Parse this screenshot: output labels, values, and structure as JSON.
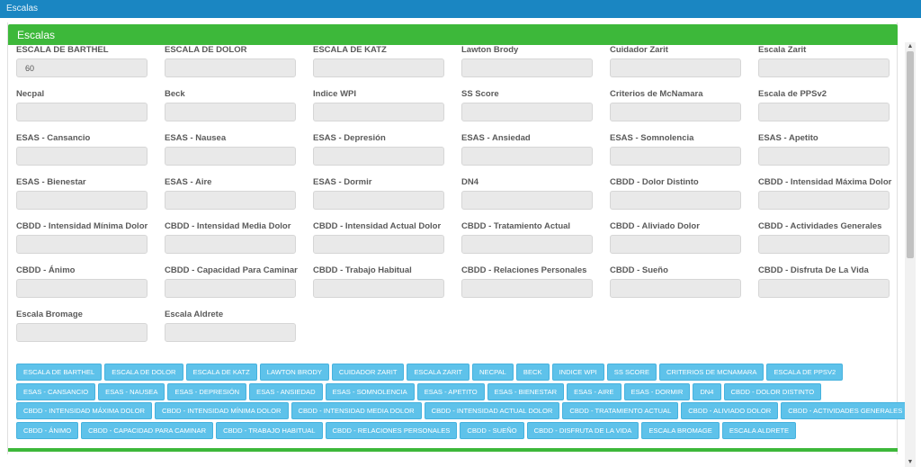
{
  "window": {
    "title": "Escalas"
  },
  "panel": {
    "title": "Escalas"
  },
  "fields": [
    {
      "label": "ESCALA DE BARTHEL",
      "value": "60"
    },
    {
      "label": "ESCALA DE DOLOR",
      "value": ""
    },
    {
      "label": "ESCALA DE KATZ",
      "value": ""
    },
    {
      "label": "Lawton Brody",
      "value": ""
    },
    {
      "label": "Cuidador Zarit",
      "value": ""
    },
    {
      "label": "Escala Zarit",
      "value": ""
    },
    {
      "label": "Necpal",
      "value": ""
    },
    {
      "label": "Beck",
      "value": ""
    },
    {
      "label": "Indice WPI",
      "value": ""
    },
    {
      "label": "SS Score",
      "value": ""
    },
    {
      "label": "Criterios de McNamara",
      "value": ""
    },
    {
      "label": "Escala de PPSv2",
      "value": ""
    },
    {
      "label": "ESAS - Cansancio",
      "value": ""
    },
    {
      "label": "ESAS - Nausea",
      "value": ""
    },
    {
      "label": "ESAS - Depresión",
      "value": ""
    },
    {
      "label": "ESAS - Ansiedad",
      "value": ""
    },
    {
      "label": "ESAS - Somnolencia",
      "value": ""
    },
    {
      "label": "ESAS - Apetito",
      "value": ""
    },
    {
      "label": "ESAS - Bienestar",
      "value": ""
    },
    {
      "label": "ESAS - Aire",
      "value": ""
    },
    {
      "label": "ESAS - Dormir",
      "value": ""
    },
    {
      "label": "DN4",
      "value": ""
    },
    {
      "label": "CBDD - Dolor Distinto",
      "value": ""
    },
    {
      "label": "CBDD - Intensidad Máxima Dolor",
      "value": ""
    },
    {
      "label": "CBDD - Intensidad Mínima Dolor",
      "value": ""
    },
    {
      "label": "CBDD - Intensidad Media Dolor",
      "value": ""
    },
    {
      "label": "CBDD - Intensidad Actual Dolor",
      "value": ""
    },
    {
      "label": "CBDD - Tratamiento Actual",
      "value": ""
    },
    {
      "label": "CBDD - Aliviado Dolor",
      "value": ""
    },
    {
      "label": "CBDD - Actividades Generales",
      "value": ""
    },
    {
      "label": "CBDD - Ánimo",
      "value": ""
    },
    {
      "label": "CBDD - Capacidad Para Caminar",
      "value": ""
    },
    {
      "label": "CBDD - Trabajo Habitual",
      "value": ""
    },
    {
      "label": "CBDD - Relaciones Personales",
      "value": ""
    },
    {
      "label": "CBDD - Sueño",
      "value": ""
    },
    {
      "label": "CBDD - Disfruta De La Vida",
      "value": ""
    },
    {
      "label": "Escala Bromage",
      "value": ""
    },
    {
      "label": "Escala Aldrete",
      "value": ""
    }
  ],
  "button_rows": [
    [
      "ESCALA DE BARTHEL",
      "ESCALA DE DOLOR",
      "ESCALA DE KATZ",
      "LAWTON BRODY",
      "CUIDADOR ZARIT",
      "ESCALA ZARIT",
      "NECPAL",
      "BECK",
      "INDICE WPI",
      "SS SCORE",
      "CRITERIOS DE MCNAMARA",
      "ESCALA DE PPSV2"
    ],
    [
      "ESAS - CANSANCIO",
      "ESAS - NAUSEA",
      "ESAS - DEPRESIÓN",
      "ESAS - ANSIEDAD",
      "ESAS - SOMNOLENCIA",
      "ESAS - APETITO",
      "ESAS - BIENESTAR",
      "ESAS - AIRE",
      "ESAS - DORMIR",
      "DN4",
      "CBDD - DOLOR DISTINTO"
    ],
    [
      "CBDD - INTENSIDAD MÁXIMA DOLOR",
      "CBDD - INTENSIDAD MÍNIMA DOLOR",
      "CBDD - INTENSIDAD MEDIA DOLOR",
      "CBDD - INTENSIDAD ACTUAL DOLOR",
      "CBDD - TRATAMIENTO ACTUAL",
      "CBDD - ALIVIADO DOLOR",
      "CBDD - ACTIVIDADES GENERALES"
    ],
    [
      "CBDD - ÁNIMO",
      "CBDD - CAPACIDAD PARA CAMINAR",
      "CBDD - TRABAJO HABITUAL",
      "CBDD - RELACIONES PERSONALES",
      "CBDD - SUEÑO",
      "CBDD - DISFRUTA DE LA VIDA",
      "ESCALA BROMAGE",
      "ESCALA ALDRETE"
    ]
  ],
  "icons": {
    "scroll_up": "chevron-up-icon",
    "scroll_down": "chevron-down-icon"
  }
}
